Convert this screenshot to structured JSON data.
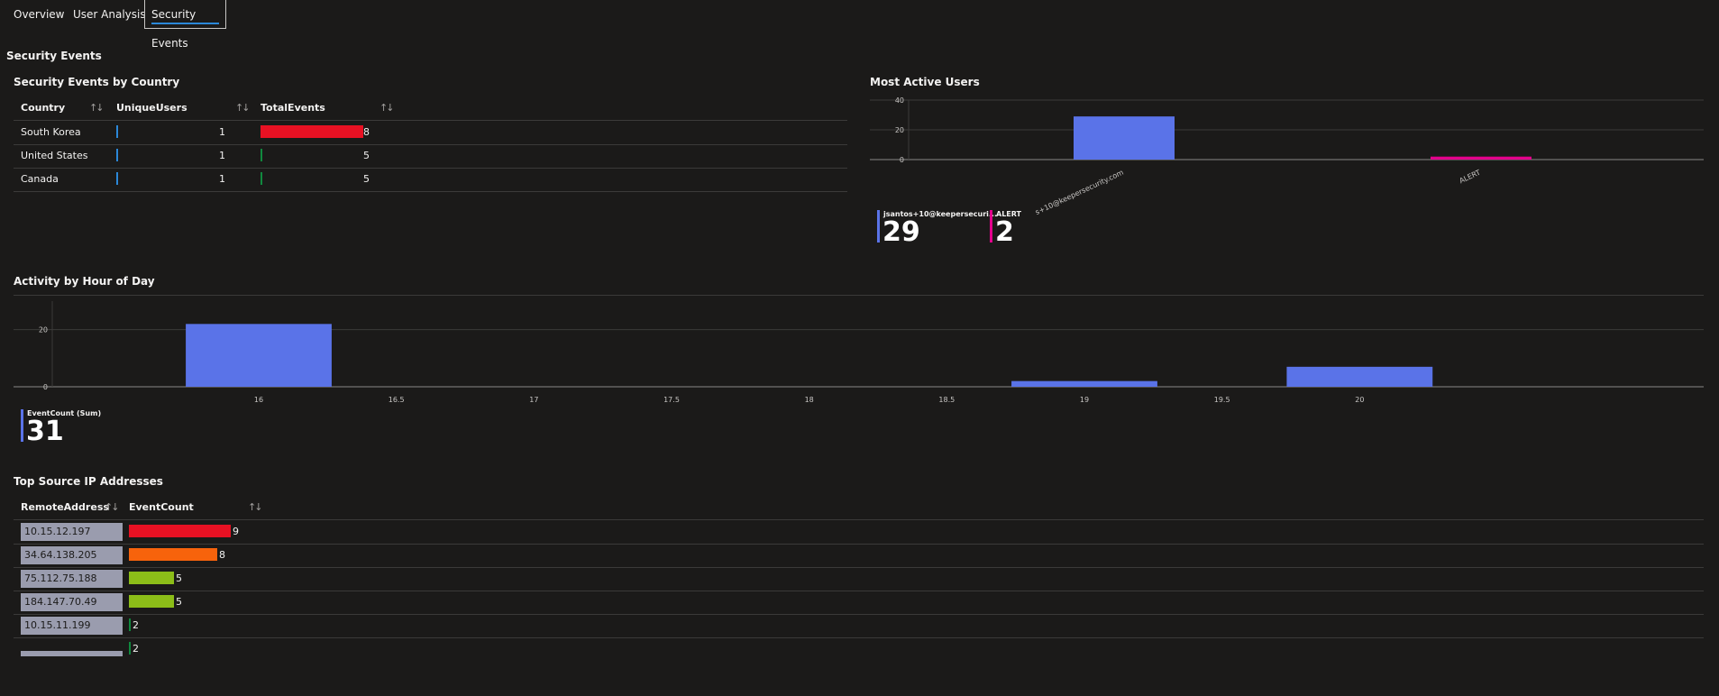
{
  "tabs": [
    {
      "label": "Overview"
    },
    {
      "label": "User Analysis"
    },
    {
      "label": "Security Events"
    }
  ],
  "section_title": "Security Events",
  "country_table": {
    "title": "Security Events by Country",
    "columns": [
      "Country",
      "UniqueUsers",
      "TotalEvents"
    ],
    "rows": [
      {
        "country": "South Korea",
        "unique_users": "1",
        "total_events": "8",
        "bar_fraction": 1.0
      },
      {
        "country": "United States",
        "unique_users": "1",
        "total_events": "5",
        "bar_fraction": 0.02
      },
      {
        "country": "Canada",
        "unique_users": "1",
        "total_events": "5",
        "bar_fraction": 0.02
      }
    ]
  },
  "active_users": {
    "title": "Most Active Users",
    "legend": [
      {
        "label": "jsantos+10@keepersecuri...",
        "value": "29",
        "color": "#5a73e8"
      },
      {
        "label": "ALERT",
        "value": "2",
        "color": "#e3008c"
      }
    ]
  },
  "hour_chart": {
    "title": "Activity by Hour of Day",
    "legend": {
      "label": "EventCount (Sum)",
      "value": "31",
      "color": "#5a73e8"
    }
  },
  "ip_table": {
    "title": "Top Source IP Addresses",
    "columns": [
      "RemoteAddress",
      "EventCount"
    ],
    "rows": [
      {
        "address": "10.15.12.197",
        "count": "9",
        "bar_fraction": 1.0,
        "color": "#e81123"
      },
      {
        "address": "34.64.138.205",
        "count": "8",
        "bar_fraction": 0.87,
        "color": "#f7630c"
      },
      {
        "address": "75.112.75.188",
        "count": "5",
        "bar_fraction": 0.44,
        "color": "#8cbd18"
      },
      {
        "address": "184.147.70.49",
        "count": "5",
        "bar_fraction": 0.44,
        "color": "#8cbd18"
      },
      {
        "address": "10.15.11.199",
        "count": "2",
        "bar_fraction": 0.02,
        "color": "#10893e"
      },
      {
        "address": "",
        "count": "2",
        "bar_fraction": 0.02,
        "color": "#10893e"
      }
    ]
  },
  "chart_data": [
    {
      "type": "bar",
      "title": "Most Active Users",
      "categories": [
        "jsantos+10@keepersecurity.com",
        "ALERT"
      ],
      "values": [
        29,
        2
      ],
      "colors": [
        "#5a73e8",
        "#e3008c"
      ],
      "ylim": [
        0,
        40
      ],
      "yticks": [
        "40",
        "20",
        "0"
      ],
      "xticklabels": [
        "s+10@keepersecurity.com",
        "ALERT"
      ]
    },
    {
      "type": "bar",
      "title": "Activity by Hour of Day",
      "x": [
        16,
        19,
        20
      ],
      "values": [
        22,
        2,
        7
      ],
      "xlim": [
        15.25,
        21.25
      ],
      "ylim": [
        0,
        30
      ],
      "yticks": [
        "20",
        "0"
      ],
      "xticks": [
        "16",
        "16.5",
        "17",
        "17.5",
        "18",
        "18.5",
        "19",
        "19.5",
        "20"
      ],
      "color": "#5a73e8"
    }
  ]
}
